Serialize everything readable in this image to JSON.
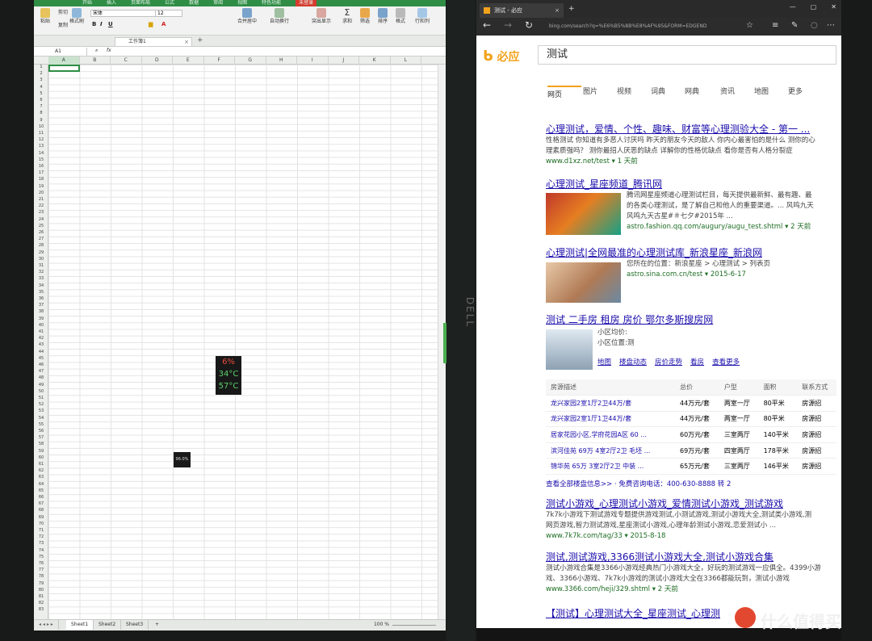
{
  "spreadsheet": {
    "ribbon_tabs": [
      "开始",
      "插入",
      "页面布局",
      "公式",
      "数据",
      "审阅",
      "视图",
      "特色功能",
      "未登录"
    ],
    "font_name": "宋体",
    "font_size": "12",
    "buttons": {
      "paste": "粘贴",
      "cut": "剪切",
      "copy": "复制",
      "format_painter": "格式刷",
      "merge": "合并居中",
      "wrap": "自动换行",
      "sum": "求和",
      "filter": "筛选",
      "sort": "排序",
      "format": "格式",
      "rows_cols": "行和列",
      "display": "突出显示"
    },
    "doc_tab": "工作簿1",
    "name_box": "A1",
    "fx": "fx",
    "columns": [
      "A",
      "B",
      "C",
      "D",
      "E",
      "F",
      "G",
      "H",
      "I",
      "J",
      "K",
      "L"
    ],
    "sheet_tabs": [
      "Sheet1",
      "Sheet2",
      "Sheet3"
    ],
    "zoom": "100 %"
  },
  "browser": {
    "tab_title": "测试 - 必应",
    "address": "bing.com/search?q=%E6%B5%8B%E8%AF%95&FORM=EDGEND",
    "logo_text": "必应",
    "query": "测试",
    "scopes": [
      "网页",
      "图片",
      "视频",
      "词典",
      "网典",
      "资讯",
      "地图",
      "更多"
    ],
    "results": [
      {
        "title": "心理测试，爱情、个性、趣味、财富等心理测验大全 - 第一 ...",
        "snippet1": "性格测试 你知道有多恶人讨厌吗 昨天的朋友今天的敌人 你内心最害怕的是什么 测你的心",
        "snippet2": "理素质强吗？ 测你最招人厌恶的缺点 详解你的性格优缺点 看你是否有人格分裂症",
        "url": "www.d1xz.net/test ▾  1 天前"
      },
      {
        "title": "心理测试_星座频道_腾讯网",
        "snippet1": "腾讯网星座频道心理测试栏目，每天提供最新鲜、最有趣、最",
        "snippet2": "的各类心理测试，是了解自己和他人的重要渠道。... 风鸣九天",
        "snippet3": "风鸣九天古星#＃七夕#2015年 ...",
        "url": "astro.fashion.qq.com/augury/augu_test.shtml ▾  2 天前"
      },
      {
        "title": "心理测试|全网最准的心理测试库_新浪星座_新浪网",
        "snippet1": "您所在的位置：新浪星座 > 心理测试 > 列表页",
        "url": "astro.sina.com.cn/test ▾  2015-6-17"
      },
      {
        "title": "测试 二手房 租房 房价 鄂尔多斯搜房网",
        "snippet1": "小区均价:",
        "snippet2": "小区位置:测"
      },
      {
        "title": "测试小游戏_心理测试小游戏_爱情测试小游戏_测试游戏",
        "snippet1": "7k7k小游戏下测试游戏专题提供游戏测试,小测试游戏,测试小游戏大全,测试类小游戏,测",
        "snippet2": "网页游戏,智力测试游戏,星座测试小游戏,心理年龄测试小游戏,恋爱测试小 ...",
        "url": "www.7k7k.com/tag/33 ▾  2015-8-18"
      },
      {
        "title": "测试,测试游戏,3366测试小游戏大全,测试小游戏合集",
        "snippet1": "测试小游戏合集是3366小游戏经典热门小游戏大全，好玩的测试游戏一应俱全。4399小游",
        "snippet2": "戏、3366小游戏、7k7k小游戏的测试小游戏大全在3366都能玩到，测试小游戏",
        "url": "www.3366.com/heji/329.shtml ▾  2 天前"
      },
      {
        "title": "【测试】心理测试大全_星座测试_心理测"
      }
    ],
    "fang_links": [
      "地图",
      "楼盘动态",
      "房价走势",
      "看房",
      "查看更多"
    ],
    "fang_headers": [
      "房源描述",
      "总价",
      "户型",
      "面积",
      "联系方式"
    ],
    "fang_rows": [
      [
        "龙兴家园2室1厅2卫44万/套",
        "44万元/套",
        "两室一厅",
        "80平米",
        "房源招"
      ],
      [
        "龙兴家园2室1厅1卫44万/套",
        "44万元/套",
        "两室一厅",
        "80平米",
        "房源招"
      ],
      [
        "居家花园小区,学府花园A区 60 ...",
        "60万元/套",
        "三室两厅",
        "140平米",
        "房源招"
      ],
      [
        "滨河佳苑 69万 4室2厅2卫 毛坯 ...",
        "69万元/套",
        "四室两厅",
        "178平米",
        "房源招"
      ],
      [
        "锦华苑 65万 3室2厅2卫 中装 ...",
        "65万元/套",
        "三室两厅",
        "146平米",
        "房源招"
      ]
    ],
    "fang_footer": "查看全部楼盘信息>>  ·  免费咨询电话：400-630-8888 转 2"
  },
  "overlay": {
    "t1": "6%",
    "t2": "34°C",
    "t3": "57°C",
    "pct": "96.0%"
  },
  "watermark": "什么值得买",
  "colors": {
    "wps_green": "#2f8d46",
    "link": "#1a0dab",
    "url_green": "#1e6d24",
    "bing_orange": "#f2a21b"
  }
}
